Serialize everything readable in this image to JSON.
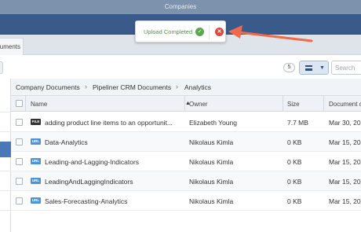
{
  "window": {
    "title": "Companies"
  },
  "tabs": [
    {
      "label": "uments"
    }
  ],
  "toolbar": {
    "count": "5",
    "search_placeholder": "Search"
  },
  "breadcrumb": [
    "Company Documents",
    "Pipeliner CRM Documents",
    "Analytics"
  ],
  "table": {
    "columns": {
      "name": "Name",
      "owner": "Owner",
      "size": "Size",
      "created": "Document c"
    },
    "rows": [
      {
        "type": "FILE",
        "name": "adding product line items to an opportunit...",
        "owner": "Elizabeth Young",
        "size": "7.7 MB",
        "date": "Mar 30, 20"
      },
      {
        "type": "URL",
        "name": "Data-Analytics",
        "owner": "Nikolaus Kimla",
        "size": "0 KB",
        "date": "Mar 15, 20"
      },
      {
        "type": "URL",
        "name": "Leading-and-Lagging-Indicators",
        "owner": "Nikolaus Kimla",
        "size": "0 KB",
        "date": "Mar 15, 20"
      },
      {
        "type": "URL",
        "name": "LeadingAndLaggingIndicators",
        "owner": "Nikolaus Kimla",
        "size": "0 KB",
        "date": "Mar 15, 20"
      },
      {
        "type": "URL",
        "name": "Sales-Forecasting-Analytics",
        "owner": "Nikolaus Kimla",
        "size": "0 KB",
        "date": "Mar 15, 20"
      }
    ]
  },
  "toast": {
    "message": "Upload Completed",
    "check_symbol": "✓",
    "close_symbol": "✕"
  },
  "colors": {
    "navbar": "#3a5a8c",
    "success": "#5aa84a",
    "error": "#e1473d",
    "arrow": "#f0694a"
  }
}
